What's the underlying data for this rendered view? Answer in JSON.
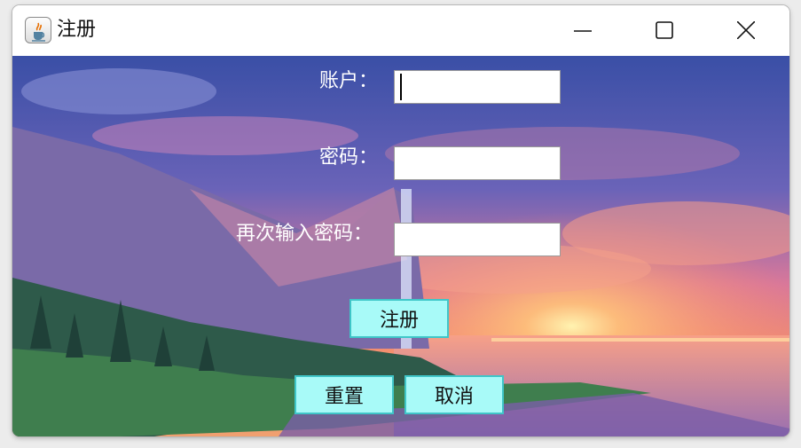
{
  "window": {
    "title": "注册",
    "icon": "java-coffee-icon",
    "controls": [
      "minimize-icon",
      "maximize-icon",
      "close-icon"
    ]
  },
  "form": {
    "account_label": "账户：",
    "account_value": "",
    "password_label": "密码：",
    "password_value": "",
    "confirm_label": "再次输入密码：",
    "confirm_value": ""
  },
  "buttons": {
    "register": "注册",
    "reset": "重置",
    "cancel": "取消"
  },
  "colors": {
    "button_fill": "#a8faf8",
    "button_border": "#3fc6c8",
    "label_text": "#ffffff"
  }
}
